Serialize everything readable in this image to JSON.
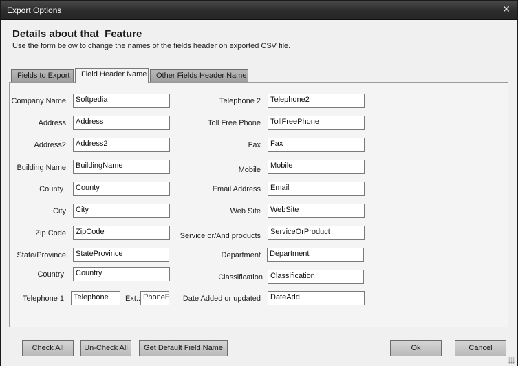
{
  "window": {
    "title": "Export Options",
    "close_glyph": "✕",
    "close_icon": "close-icon"
  },
  "header": {
    "title": "Details about that  Feature",
    "subtitle": "Use the form below to change the names of the fields header on exported CSV file."
  },
  "tabs": [
    {
      "label": "Fields to Export",
      "active": false
    },
    {
      "label": "Field Header Name",
      "active": true
    },
    {
      "label": "Other Fields Header Name",
      "active": false
    }
  ],
  "left_fields": [
    {
      "label": "Company Name",
      "value": "Softpedia"
    },
    {
      "label": "Address",
      "value": "Address"
    },
    {
      "label": "Address2",
      "value": "Address2"
    },
    {
      "label": "Building Name",
      "value": "BuildingName"
    },
    {
      "label": "County",
      "value": "County"
    },
    {
      "label": "City",
      "value": "City"
    },
    {
      "label": "Zip Code",
      "value": "ZipCode"
    },
    {
      "label": "State/Province",
      "value": "StateProvince"
    },
    {
      "label": "Country",
      "value": "Country"
    }
  ],
  "telephone1": {
    "label": "Telephone 1",
    "value": "Telephone",
    "ext_label": "Ext.:",
    "ext_value": "PhoneExt"
  },
  "right_fields": [
    {
      "label": "Telephone 2",
      "value": "Telephone2"
    },
    {
      "label": "Toll Free Phone",
      "value": "TollFreePhone"
    },
    {
      "label": "Fax",
      "value": "Fax"
    },
    {
      "label": "Mobile",
      "value": "Mobile"
    },
    {
      "label": "Email Address",
      "value": "Email"
    },
    {
      "label": "Web Site",
      "value": "WebSite"
    },
    {
      "label": "Service or/And products",
      "value": "ServiceOrProduct"
    },
    {
      "label": "Department",
      "value": "Department"
    },
    {
      "label": "Classification",
      "value": "Classification"
    },
    {
      "label": "Date Added or updated",
      "value": "DateAdd"
    }
  ],
  "buttons": {
    "check_all": "Check All",
    "uncheck_all": "Un-Check All",
    "default_names": "Get Default Field Name",
    "ok": "Ok",
    "cancel": "Cancel"
  }
}
